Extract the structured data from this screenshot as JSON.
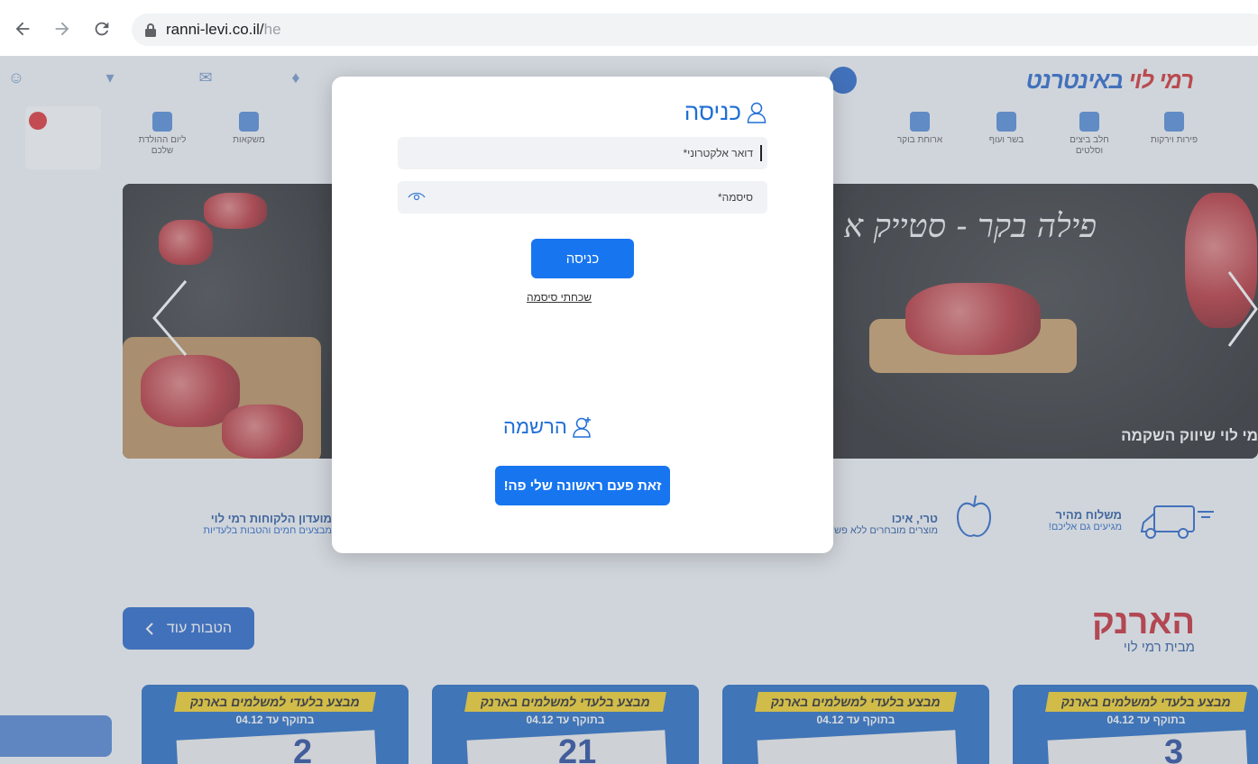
{
  "browser": {
    "url_domain": "ranni-levi.co.il/",
    "url_path": "he"
  },
  "modal": {
    "login_title": "כניסה",
    "email_placeholder": "דואר אלקטרוני*",
    "password_placeholder": "סיסמה*",
    "login_button": "כניסה",
    "forgot_password": "שכחתי סיסמה",
    "register_title": "הרשמה",
    "first_time_button": "זאת פעם ראשונה שלי פה!"
  },
  "banner": {
    "script_text": "פילה בקר - סטייק א",
    "brand_text": "מי לוי שיווק השקמה"
  },
  "features": {
    "shipping_title": "משלוח מהיר",
    "shipping_sub": "מגיעים גם אליכם!",
    "fresh_title": "טרי, איכו",
    "fresh_sub": "מוצרים מובחרים ללא פש",
    "club_title": "מועדון הלקוחות רמי לוי",
    "club_sub": "מבצעים חמים והטבות בלעדיות"
  },
  "promo": {
    "more_button": "הטבות עוד",
    "arnak_title": "הארנק",
    "arnak_sub": "מבית רמי לוי",
    "cards": [
      {
        "tag": "מבצע בלעדי למשלמים בארנק",
        "date": "בתוקף עד 04.12",
        "num": "2"
      },
      {
        "tag": "מבצע בלעדי למשלמים בארנק",
        "date": "בתוקף עד 04.12",
        "num": "21"
      },
      {
        "tag": "מבצע בלעדי למשלמים בארנק",
        "date": "בתוקף עד 04.12",
        "num": ""
      },
      {
        "tag": "מבצע בלעדי למשלמים בארנק",
        "date": "בתוקף עד 04.12",
        "num": "3"
      }
    ]
  },
  "colors": {
    "brand_blue": "#1775f0",
    "title_blue": "#1f6fd6",
    "accent_red": "#d12424",
    "promo_yellow": "#f6d21c"
  }
}
